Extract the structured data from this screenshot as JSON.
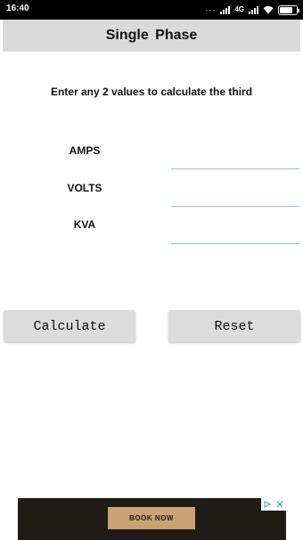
{
  "status_bar": {
    "time": "16:40",
    "dots": "···",
    "network": "4G",
    "battery_level": 0.8
  },
  "header": {
    "title": "Single  Phase"
  },
  "main": {
    "instruction": "Enter any 2 values to calculate the third",
    "fields": [
      {
        "label": "AMPS",
        "value": ""
      },
      {
        "label": "VOLTS",
        "value": ""
      },
      {
        "label": "KVA",
        "value": ""
      }
    ]
  },
  "buttons": {
    "calculate": "Calculate",
    "reset": "Reset"
  },
  "ad": {
    "cta": "BOOK NOW",
    "choices_icon": "adchoices-icon",
    "close_icon": "close-icon"
  },
  "colors": {
    "title_bar": "#dadada",
    "input_underline": "#8cc6c6",
    "button": "#dcdcdc",
    "ad_background": "#1f1b16",
    "ad_button": "#c9a276"
  }
}
